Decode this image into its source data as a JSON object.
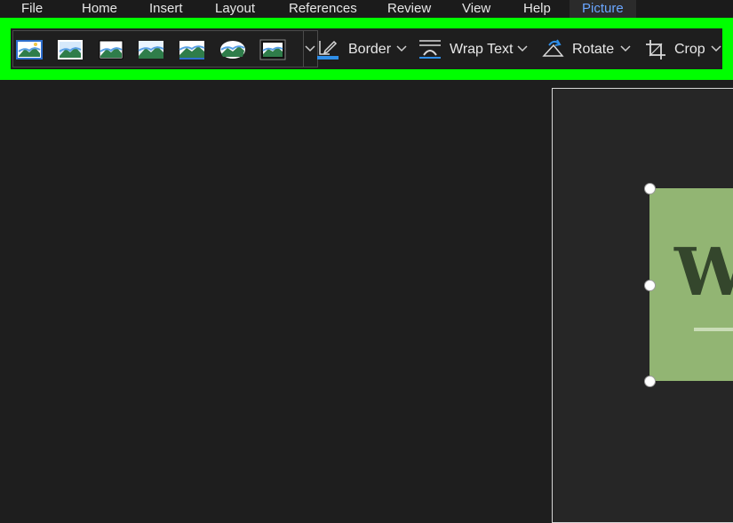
{
  "menu": {
    "items": [
      "File",
      "Home",
      "Insert",
      "Layout",
      "References",
      "Review",
      "View",
      "Help",
      "Picture"
    ],
    "active": "Picture"
  },
  "ribbon": {
    "picture_styles": [
      "style-1",
      "style-2",
      "style-3",
      "style-4",
      "style-5",
      "style-6",
      "style-7"
    ],
    "border_label": "Border",
    "wrap_text_label": "Wrap Text",
    "rotate_label": "Rotate",
    "crop_label": "Crop"
  },
  "document": {
    "picture_text": "W"
  },
  "colors": {
    "accent": "#6aa6ff",
    "highlight": "#00ff00",
    "picture_bg": "#92b573",
    "picture_text": "#34462c"
  }
}
